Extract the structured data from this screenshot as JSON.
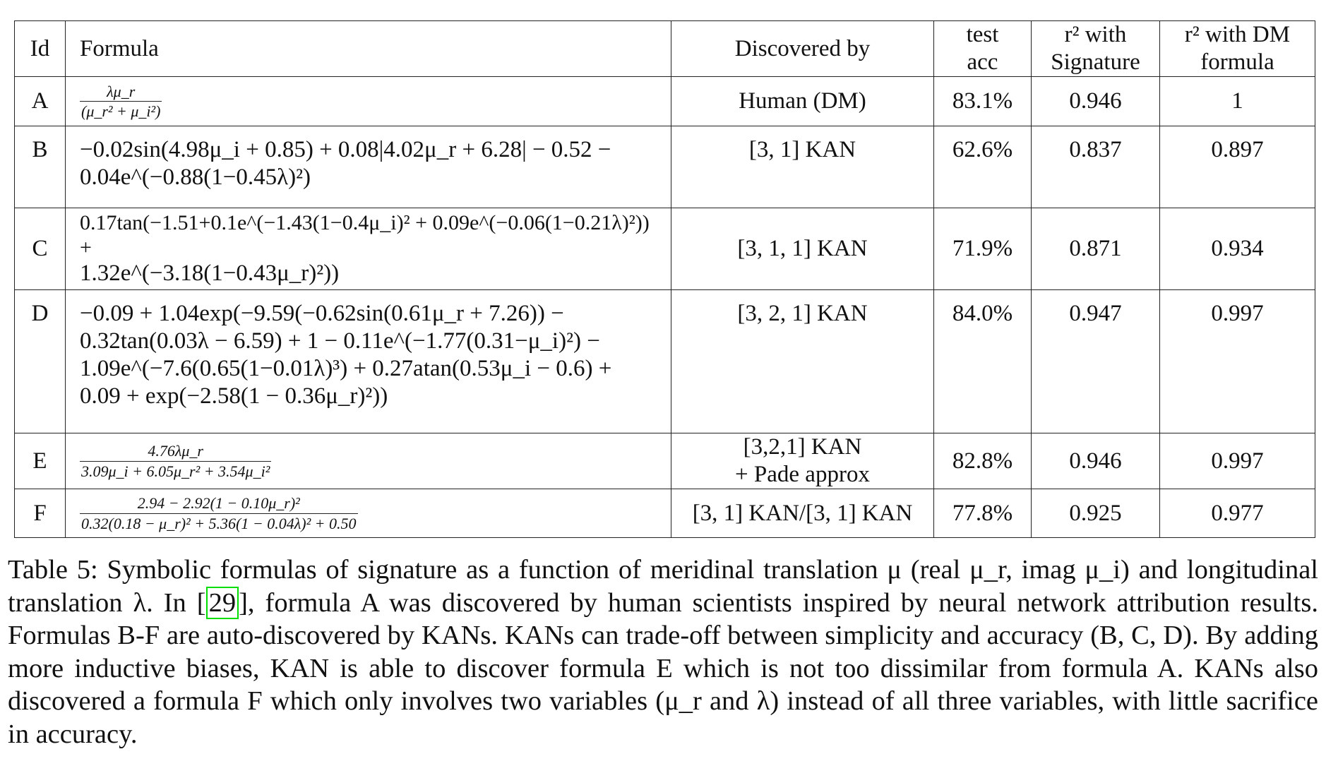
{
  "table": {
    "headers": {
      "id": "Id",
      "formula": "Formula",
      "discovered_by": "Discovered by",
      "test_acc_line1": "test",
      "test_acc_line2": "acc",
      "r2_sig_line1": "r² with",
      "r2_sig_line2": "Signature",
      "r2_dm_line1": "r² with DM",
      "r2_dm_line2": "formula"
    },
    "rows": [
      {
        "id": "A",
        "formula_num": "λμ_r",
        "formula_den": "(μ_r² + μ_i²)",
        "discovered_by": "Human (DM)",
        "test_acc": "83.1%",
        "r2_signature": "0.946",
        "r2_dm": "1"
      },
      {
        "id": "B",
        "formula_line1": "−0.02sin(4.98μ_i + 0.85) + 0.08|4.02μ_r + 6.28| − 0.52 −",
        "formula_line2": "0.04e^(−0.88(1−0.45λ)²)",
        "discovered_by": "[3, 1] KAN",
        "test_acc": "62.6%",
        "r2_signature": "0.837",
        "r2_dm": "0.897"
      },
      {
        "id": "C",
        "formula_line1": "0.17tan(−1.51+0.1e^(−1.43(1−0.4μ_i)² + 0.09e^(−0.06(1−0.21λ)²)) +",
        "formula_line2": "1.32e^(−3.18(1−0.43μ_r)²))",
        "discovered_by": "[3, 1, 1] KAN",
        "test_acc": "71.9%",
        "r2_signature": "0.871",
        "r2_dm": "0.934"
      },
      {
        "id": "D",
        "formula_line1": "−0.09 + 1.04exp(−9.59(−0.62sin(0.61μ_r + 7.26)) −",
        "formula_line2": "0.32tan(0.03λ − 6.59) + 1 − 0.11e^(−1.77(0.31−μ_i)²) −",
        "formula_line3": "1.09e^(−7.6(0.65(1−0.01λ)³) + 0.27atan(0.53μ_i − 0.6) +",
        "formula_line4": "0.09 + exp(−2.58(1 − 0.36μ_r)²))",
        "discovered_by": "[3, 2, 1] KAN",
        "test_acc": "84.0%",
        "r2_signature": "0.947",
        "r2_dm": "0.997"
      },
      {
        "id": "E",
        "formula_num": "4.76λμ_r",
        "formula_den": "3.09μ_i + 6.05μ_r² + 3.54μ_i²",
        "discovered_by_line1": "[3,2,1] KAN",
        "discovered_by_line2": "+ Pade approx",
        "test_acc": "82.8%",
        "r2_signature": "0.946",
        "r2_dm": "0.997"
      },
      {
        "id": "F",
        "formula_num": "2.94 − 2.92(1 − 0.10μ_r)²",
        "formula_den": "0.32(0.18 − μ_r)² + 5.36(1 − 0.04λ)² + 0.50",
        "discovered_by": "[3, 1] KAN/[3, 1] KAN",
        "test_acc": "77.8%",
        "r2_signature": "0.925",
        "r2_dm": "0.977"
      }
    ]
  },
  "caption": {
    "part1": "Table 5: Symbolic formulas of signature as a function of meridinal translation μ (real μ_r, imag μ_i) and longitudinal translation λ. In [",
    "citation": "29",
    "part2": "], formula A was discovered by human scientists inspired by neural network attribution results. Formulas B-F are auto-discovered by KANs. KANs can trade-off between simplicity and accuracy (B, C, D). By adding more inductive biases, KAN is able to discover formula E which is not too dissimilar from formula A. KANs also discovered a formula F which only involves two variables (μ_r and λ) instead of all three variables, with little sacrifice in accuracy."
  },
  "colors": {
    "citation_box": "#00dd00",
    "text": "#111111",
    "rule": "#222222"
  }
}
